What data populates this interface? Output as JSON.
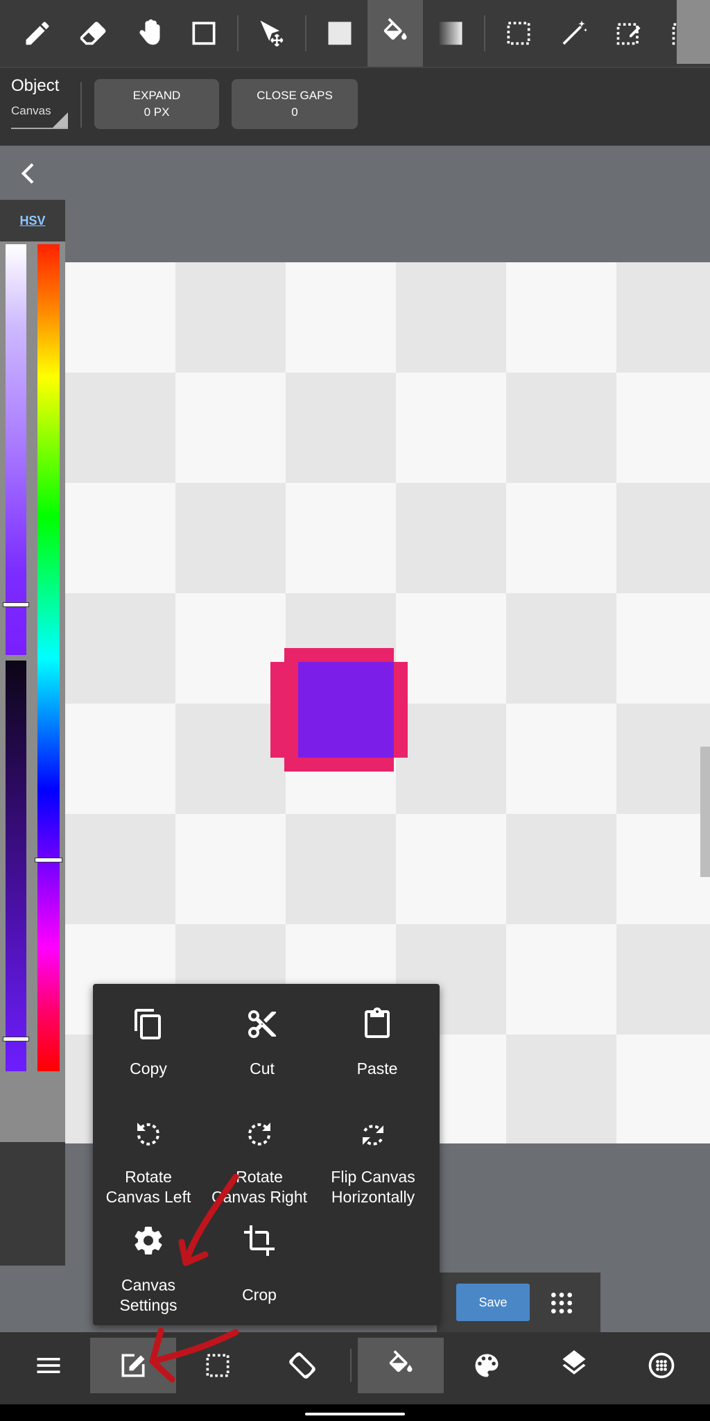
{
  "top_toolbar": {
    "tools": [
      "pen-icon",
      "eraser-icon",
      "hand-icon",
      "rectangle-icon",
      "move-select-icon",
      "fill-rect-icon",
      "bucket-icon",
      "gradient-icon",
      "select-rect-icon",
      "magic-wand-icon",
      "select-pen-icon",
      "select-eraser-icon"
    ],
    "active_tool": "bucket-icon"
  },
  "sub_toolbar": {
    "object_label": "Object",
    "object_value": "Canvas",
    "expand_line1": "EXPAND",
    "expand_line2": "0 PX",
    "close_gaps_line1": "CLOSE GAPS",
    "close_gaps_line2": "0"
  },
  "color_panel": {
    "mode_label": "HSV",
    "current_color": "#7b1fe8"
  },
  "canvas": {
    "shape_fill": "#7b1fe8",
    "shape_outline": "#e8236a"
  },
  "popup_menu": {
    "items": [
      {
        "icon": "copy-icon",
        "label": "Copy"
      },
      {
        "icon": "scissors-icon",
        "label": "Cut"
      },
      {
        "icon": "clipboard-icon",
        "label": "Paste"
      },
      {
        "icon": "rotate-left-icon",
        "label_line1": "Rotate",
        "label_line2": "Canvas Left"
      },
      {
        "icon": "rotate-right-icon",
        "label_line1": "Rotate",
        "label_line2": "Canvas Right"
      },
      {
        "icon": "flip-icon",
        "label_line1": "Flip Canvas",
        "label_line2": "Horizontally"
      },
      {
        "icon": "gear-icon",
        "label_line1": "Canvas",
        "label_line2": "Settings"
      },
      {
        "icon": "crop-icon",
        "label": "Crop"
      }
    ]
  },
  "save_bar": {
    "save_label": "Save"
  },
  "bottom_nav": {
    "items": [
      "menu-icon",
      "edit-icon",
      "selection-icon",
      "rotate-screen-icon",
      "bucket-icon",
      "palette-icon",
      "layers-icon",
      "material-icon"
    ],
    "active_items": [
      "edit-icon",
      "bucket-icon"
    ]
  }
}
